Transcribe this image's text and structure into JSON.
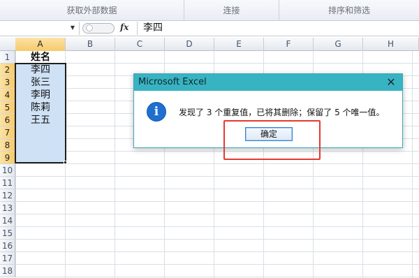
{
  "ribbon": {
    "groups": [
      "获取外部数据",
      "连接",
      "排序和筛选"
    ]
  },
  "formula_bar": {
    "fx_label": "fx",
    "value": "李四"
  },
  "grid": {
    "columns": [
      "A",
      "B",
      "C",
      "D",
      "E",
      "F",
      "G",
      "H"
    ],
    "rows": [
      "1",
      "2",
      "3",
      "4",
      "5",
      "6",
      "7",
      "8",
      "9",
      "10",
      "11",
      "12",
      "13",
      "14",
      "15",
      "16",
      "17",
      "18"
    ],
    "column_a": [
      "姓名",
      "李四",
      "张三",
      "李明",
      "陈莉",
      "王五"
    ]
  },
  "dialog": {
    "title": "Microsoft Excel",
    "close_glyph": "✕",
    "info_glyph": "i",
    "message": "发现了 3 个重复值，已将其删除；保留了 5 个唯一值。",
    "ok_label": "确定"
  },
  "colors": {
    "title_bar": "#38b3c2",
    "selection_fill": "#cfe1f5",
    "highlight_box": "#e23a2e",
    "info_icon": "#1e6fd0"
  }
}
